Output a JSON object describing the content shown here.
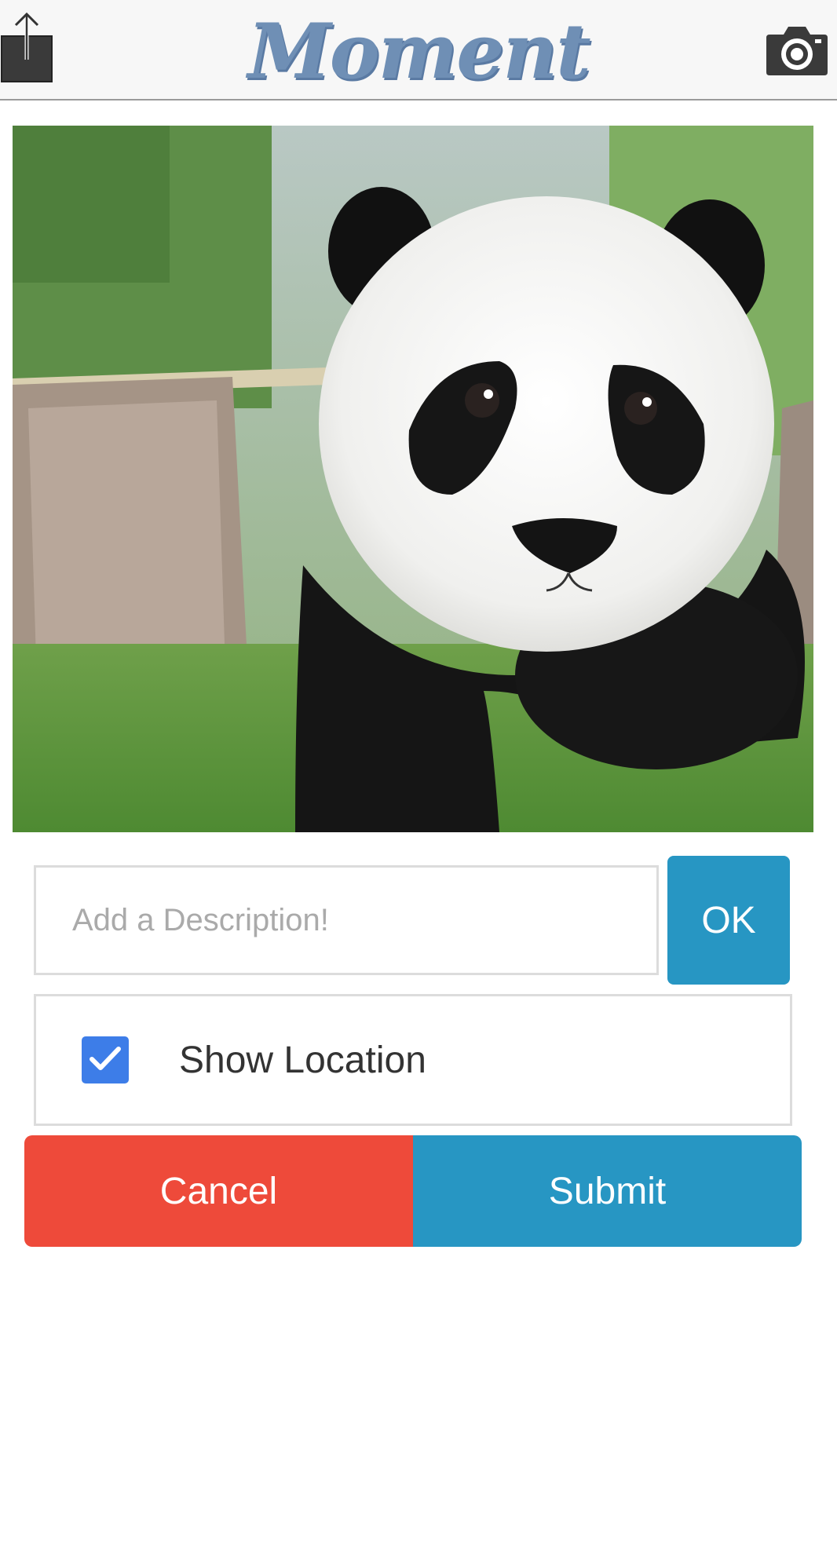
{
  "header": {
    "logo_text": "Moment",
    "share_icon": "share-upload-icon",
    "camera_icon": "camera-icon"
  },
  "photo": {
    "subject": "panda-photo"
  },
  "description": {
    "placeholder": "Add a Description!",
    "value": "",
    "ok_label": "OK"
  },
  "location": {
    "label": "Show Location",
    "checked": true
  },
  "actions": {
    "cancel_label": "Cancel",
    "submit_label": "Submit"
  },
  "colors": {
    "logo": "#6f8fb5",
    "accent_blue": "#2796c3",
    "cancel_red": "#ee4a3a",
    "checkbox_blue": "#3d7de8",
    "header_bg": "#f7f7f7"
  }
}
